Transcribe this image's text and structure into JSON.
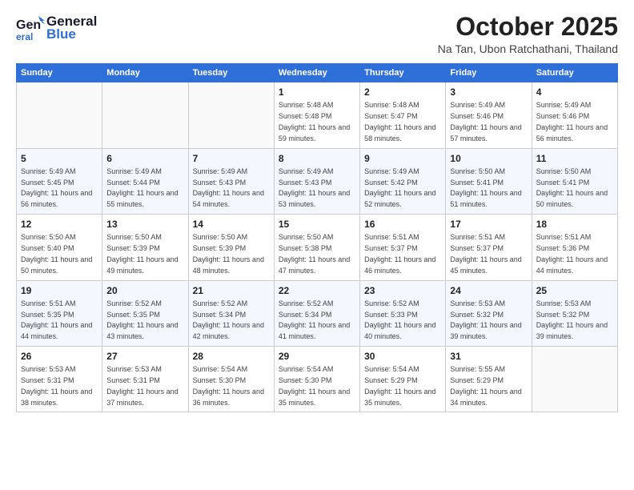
{
  "header": {
    "logo_general": "General",
    "logo_blue": "Blue",
    "month_title": "October 2025",
    "location": "Na Tan, Ubon Ratchathani, Thailand"
  },
  "weekdays": [
    "Sunday",
    "Monday",
    "Tuesday",
    "Wednesday",
    "Thursday",
    "Friday",
    "Saturday"
  ],
  "weeks": [
    [
      {
        "day": "",
        "sunrise": "",
        "sunset": "",
        "daylight": ""
      },
      {
        "day": "",
        "sunrise": "",
        "sunset": "",
        "daylight": ""
      },
      {
        "day": "",
        "sunrise": "",
        "sunset": "",
        "daylight": ""
      },
      {
        "day": "1",
        "sunrise": "Sunrise: 5:48 AM",
        "sunset": "Sunset: 5:48 PM",
        "daylight": "Daylight: 11 hours and 59 minutes."
      },
      {
        "day": "2",
        "sunrise": "Sunrise: 5:48 AM",
        "sunset": "Sunset: 5:47 PM",
        "daylight": "Daylight: 11 hours and 58 minutes."
      },
      {
        "day": "3",
        "sunrise": "Sunrise: 5:49 AM",
        "sunset": "Sunset: 5:46 PM",
        "daylight": "Daylight: 11 hours and 57 minutes."
      },
      {
        "day": "4",
        "sunrise": "Sunrise: 5:49 AM",
        "sunset": "Sunset: 5:46 PM",
        "daylight": "Daylight: 11 hours and 56 minutes."
      }
    ],
    [
      {
        "day": "5",
        "sunrise": "Sunrise: 5:49 AM",
        "sunset": "Sunset: 5:45 PM",
        "daylight": "Daylight: 11 hours and 56 minutes."
      },
      {
        "day": "6",
        "sunrise": "Sunrise: 5:49 AM",
        "sunset": "Sunset: 5:44 PM",
        "daylight": "Daylight: 11 hours and 55 minutes."
      },
      {
        "day": "7",
        "sunrise": "Sunrise: 5:49 AM",
        "sunset": "Sunset: 5:43 PM",
        "daylight": "Daylight: 11 hours and 54 minutes."
      },
      {
        "day": "8",
        "sunrise": "Sunrise: 5:49 AM",
        "sunset": "Sunset: 5:43 PM",
        "daylight": "Daylight: 11 hours and 53 minutes."
      },
      {
        "day": "9",
        "sunrise": "Sunrise: 5:49 AM",
        "sunset": "Sunset: 5:42 PM",
        "daylight": "Daylight: 11 hours and 52 minutes."
      },
      {
        "day": "10",
        "sunrise": "Sunrise: 5:50 AM",
        "sunset": "Sunset: 5:41 PM",
        "daylight": "Daylight: 11 hours and 51 minutes."
      },
      {
        "day": "11",
        "sunrise": "Sunrise: 5:50 AM",
        "sunset": "Sunset: 5:41 PM",
        "daylight": "Daylight: 11 hours and 50 minutes."
      }
    ],
    [
      {
        "day": "12",
        "sunrise": "Sunrise: 5:50 AM",
        "sunset": "Sunset: 5:40 PM",
        "daylight": "Daylight: 11 hours and 50 minutes."
      },
      {
        "day": "13",
        "sunrise": "Sunrise: 5:50 AM",
        "sunset": "Sunset: 5:39 PM",
        "daylight": "Daylight: 11 hours and 49 minutes."
      },
      {
        "day": "14",
        "sunrise": "Sunrise: 5:50 AM",
        "sunset": "Sunset: 5:39 PM",
        "daylight": "Daylight: 11 hours and 48 minutes."
      },
      {
        "day": "15",
        "sunrise": "Sunrise: 5:50 AM",
        "sunset": "Sunset: 5:38 PM",
        "daylight": "Daylight: 11 hours and 47 minutes."
      },
      {
        "day": "16",
        "sunrise": "Sunrise: 5:51 AM",
        "sunset": "Sunset: 5:37 PM",
        "daylight": "Daylight: 11 hours and 46 minutes."
      },
      {
        "day": "17",
        "sunrise": "Sunrise: 5:51 AM",
        "sunset": "Sunset: 5:37 PM",
        "daylight": "Daylight: 11 hours and 45 minutes."
      },
      {
        "day": "18",
        "sunrise": "Sunrise: 5:51 AM",
        "sunset": "Sunset: 5:36 PM",
        "daylight": "Daylight: 11 hours and 44 minutes."
      }
    ],
    [
      {
        "day": "19",
        "sunrise": "Sunrise: 5:51 AM",
        "sunset": "Sunset: 5:35 PM",
        "daylight": "Daylight: 11 hours and 44 minutes."
      },
      {
        "day": "20",
        "sunrise": "Sunrise: 5:52 AM",
        "sunset": "Sunset: 5:35 PM",
        "daylight": "Daylight: 11 hours and 43 minutes."
      },
      {
        "day": "21",
        "sunrise": "Sunrise: 5:52 AM",
        "sunset": "Sunset: 5:34 PM",
        "daylight": "Daylight: 11 hours and 42 minutes."
      },
      {
        "day": "22",
        "sunrise": "Sunrise: 5:52 AM",
        "sunset": "Sunset: 5:34 PM",
        "daylight": "Daylight: 11 hours and 41 minutes."
      },
      {
        "day": "23",
        "sunrise": "Sunrise: 5:52 AM",
        "sunset": "Sunset: 5:33 PM",
        "daylight": "Daylight: 11 hours and 40 minutes."
      },
      {
        "day": "24",
        "sunrise": "Sunrise: 5:53 AM",
        "sunset": "Sunset: 5:32 PM",
        "daylight": "Daylight: 11 hours and 39 minutes."
      },
      {
        "day": "25",
        "sunrise": "Sunrise: 5:53 AM",
        "sunset": "Sunset: 5:32 PM",
        "daylight": "Daylight: 11 hours and 39 minutes."
      }
    ],
    [
      {
        "day": "26",
        "sunrise": "Sunrise: 5:53 AM",
        "sunset": "Sunset: 5:31 PM",
        "daylight": "Daylight: 11 hours and 38 minutes."
      },
      {
        "day": "27",
        "sunrise": "Sunrise: 5:53 AM",
        "sunset": "Sunset: 5:31 PM",
        "daylight": "Daylight: 11 hours and 37 minutes."
      },
      {
        "day": "28",
        "sunrise": "Sunrise: 5:54 AM",
        "sunset": "Sunset: 5:30 PM",
        "daylight": "Daylight: 11 hours and 36 minutes."
      },
      {
        "day": "29",
        "sunrise": "Sunrise: 5:54 AM",
        "sunset": "Sunset: 5:30 PM",
        "daylight": "Daylight: 11 hours and 35 minutes."
      },
      {
        "day": "30",
        "sunrise": "Sunrise: 5:54 AM",
        "sunset": "Sunset: 5:29 PM",
        "daylight": "Daylight: 11 hours and 35 minutes."
      },
      {
        "day": "31",
        "sunrise": "Sunrise: 5:55 AM",
        "sunset": "Sunset: 5:29 PM",
        "daylight": "Daylight: 11 hours and 34 minutes."
      },
      {
        "day": "",
        "sunrise": "",
        "sunset": "",
        "daylight": ""
      }
    ]
  ]
}
